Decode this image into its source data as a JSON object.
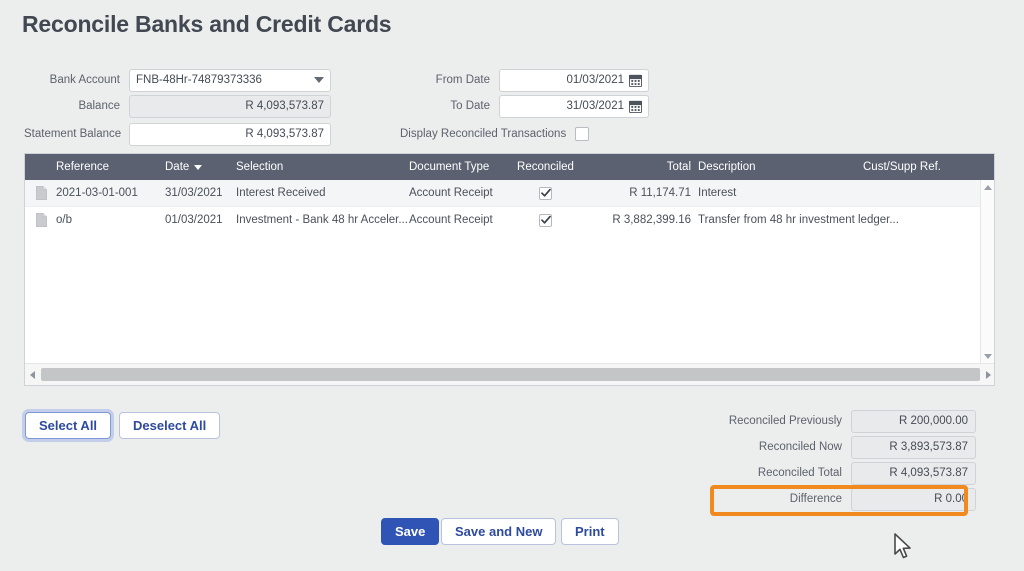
{
  "page": {
    "title": "Reconcile Banks and Credit Cards",
    "accent_orange": "#f08a1e",
    "accent_blue": "#2f54b5",
    "header_bg": "#5b6170",
    "background": "#eceded"
  },
  "form": {
    "left": [
      {
        "label": "Bank Account",
        "value": "FNB-48Hr-74879373336",
        "type": "dropdown",
        "readonly": false
      },
      {
        "label": "Balance",
        "value": "R 4,093,573.87",
        "type": "text",
        "readonly": true
      },
      {
        "label": "Statement Balance",
        "value": "R 4,093,573.87",
        "type": "text",
        "readonly": false
      }
    ],
    "right": [
      {
        "label": "From Date",
        "value": "01/03/2021",
        "type": "date"
      },
      {
        "label": "To Date",
        "value": "31/03/2021",
        "type": "date"
      }
    ],
    "display_reconciled": {
      "label": "Display Reconciled Transactions",
      "checked": false
    }
  },
  "table": {
    "columns": [
      {
        "key": "icon",
        "label": ""
      },
      {
        "key": "ref",
        "label": "Reference"
      },
      {
        "key": "date",
        "label": "Date",
        "sorted": "desc"
      },
      {
        "key": "sel",
        "label": "Selection"
      },
      {
        "key": "doc",
        "label": "Document Type"
      },
      {
        "key": "rec",
        "label": "Reconciled"
      },
      {
        "key": "tot",
        "label": "Total"
      },
      {
        "key": "desc",
        "label": "Description"
      },
      {
        "key": "cust",
        "label": "Cust/Supp Ref."
      }
    ],
    "rows": [
      {
        "icon": "document-icon",
        "ref": "2021-03-01-001",
        "date": "31/03/2021",
        "sel": "Interest Received",
        "doc": "Account Receipt",
        "rec": true,
        "tot": "R 11,174.71",
        "desc": "Interest",
        "cust": ""
      },
      {
        "icon": "document-icon",
        "ref": "o/b",
        "date": "01/03/2021",
        "sel": "Investment - Bank 48 hr Acceler...",
        "doc": "Account Receipt",
        "rec": true,
        "tot": "R 3,882,399.16",
        "desc": "Transfer from 48 hr investment ledger...",
        "cust": ""
      }
    ]
  },
  "selection_buttons": {
    "select_all": "Select All",
    "deselect_all": "Deselect All"
  },
  "action_buttons": {
    "save": "Save",
    "save_and_new": "Save and New",
    "print": "Print"
  },
  "totals": [
    {
      "label": "Reconciled Previously",
      "value": "R 200,000.00",
      "highlighted": false
    },
    {
      "label": "Reconciled Now",
      "value": "R 3,893,573.87",
      "highlighted": false
    },
    {
      "label": "Reconciled Total",
      "value": "R 4,093,573.87",
      "highlighted": false
    },
    {
      "label": "Difference",
      "value": "R 0.00",
      "highlighted": true
    }
  ]
}
